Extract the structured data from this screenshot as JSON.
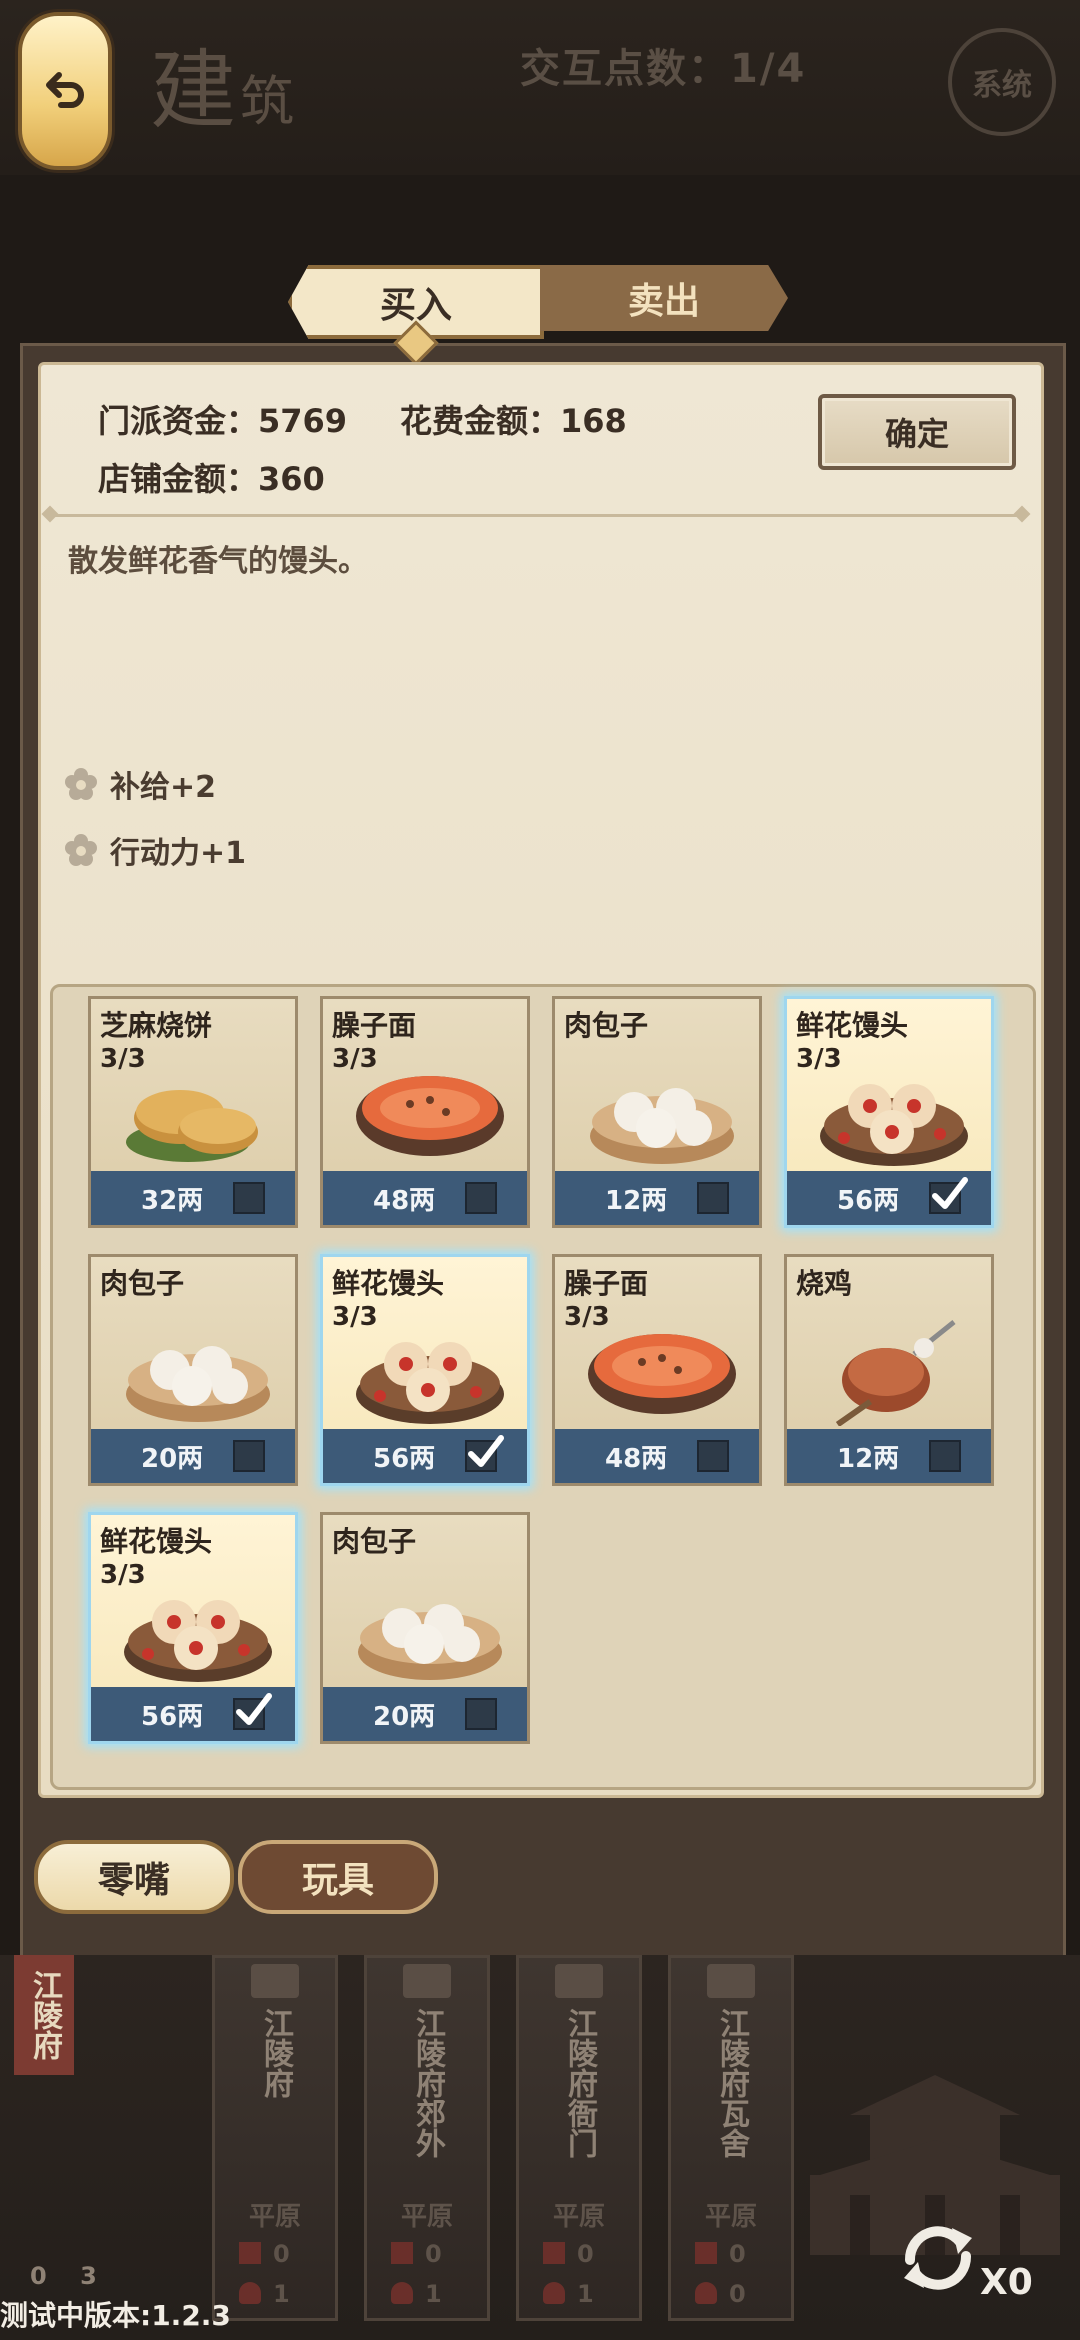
{
  "header": {
    "building_title": "建",
    "building_title_small": "筑",
    "interaction_count": "交互点数：1/4",
    "system_label": "系统"
  },
  "tabs": {
    "buy": "买入",
    "sell": "卖出"
  },
  "shop": {
    "sect_funds": "门派资金：5769",
    "spend_amount": "花费金额：168",
    "shop_amount": "店铺金额：360",
    "confirm": "确定",
    "description": "散发鲜花香气的馒头。",
    "effects": [
      "补给+2",
      "行动力+1"
    ]
  },
  "items": [
    {
      "name": "芝麻烧饼",
      "stock": "3/3",
      "price": "32两",
      "selected": false,
      "icon": "sesame-cake-icon"
    },
    {
      "name": "臊子面",
      "stock": "3/3",
      "price": "48两",
      "selected": false,
      "icon": "noodle-bowl-icon"
    },
    {
      "name": "肉包子",
      "stock": "",
      "price": "12两",
      "selected": false,
      "icon": "steamed-bun-icon"
    },
    {
      "name": "鲜花馒头",
      "stock": "3/3",
      "price": "56两",
      "selected": true,
      "icon": "flower-bun-icon"
    },
    {
      "name": "肉包子",
      "stock": "",
      "price": "20两",
      "selected": false,
      "icon": "steamed-bun-icon"
    },
    {
      "name": "鲜花馒头",
      "stock": "3/3",
      "price": "56两",
      "selected": true,
      "icon": "flower-bun-icon"
    },
    {
      "name": "臊子面",
      "stock": "3/3",
      "price": "48两",
      "selected": false,
      "icon": "noodle-bowl-icon"
    },
    {
      "name": "烧鸡",
      "stock": "",
      "price": "12两",
      "selected": false,
      "icon": "roast-chicken-icon"
    },
    {
      "name": "鲜花馒头",
      "stock": "3/3",
      "price": "56两",
      "selected": true,
      "icon": "flower-bun-icon"
    },
    {
      "name": "肉包子",
      "stock": "",
      "price": "20两",
      "selected": false,
      "icon": "steamed-bun-icon"
    }
  ],
  "categories": {
    "snack": "零嘴",
    "toy": "玩具"
  },
  "map": {
    "current_city": "江陵府",
    "locations": [
      {
        "name": "江陵府",
        "terrain": "平原",
        "count1": "0",
        "count2": "1"
      },
      {
        "name": "江陵府郊外",
        "terrain": "平原",
        "count1": "0",
        "count2": "1"
      },
      {
        "name": "江陵府衙门",
        "terrain": "平原",
        "count1": "0",
        "count2": "1"
      },
      {
        "name": "江陵府瓦舍",
        "terrain": "平原",
        "count1": "0",
        "count2": "0"
      }
    ],
    "left_count1": "0",
    "left_count2": "3",
    "refresh_count": "X0"
  },
  "version": "测试中版本:1.2.3",
  "colors": {
    "accent_gold": "#f1cf7a",
    "card_footer": "#3d5a78",
    "selected_glow": "#9ee3ff"
  }
}
